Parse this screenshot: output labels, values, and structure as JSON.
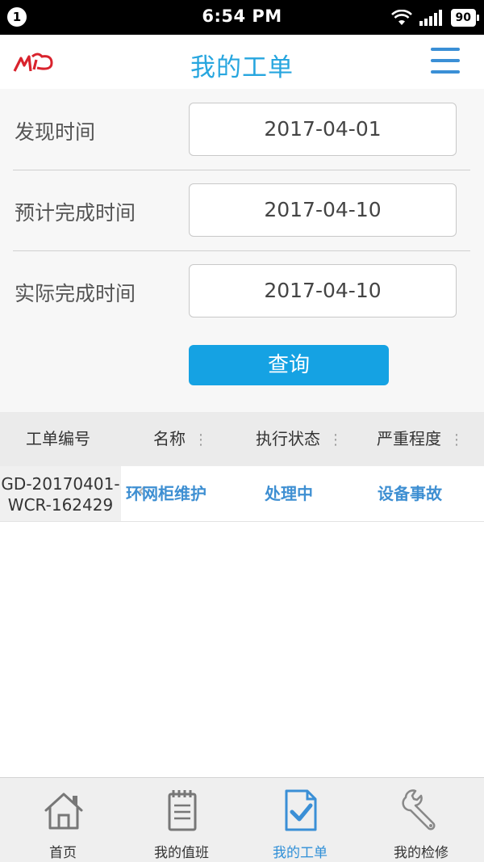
{
  "status_bar": {
    "notification_count": "1",
    "time": "6:54 PM",
    "battery": "90",
    "icons": [
      "wifi-icon",
      "signal-icon",
      "battery-icon"
    ]
  },
  "header": {
    "title": "我的工单",
    "logo_icon": "logo-icon",
    "menu_icon": "hamburger-menu-icon"
  },
  "filters": {
    "discover_time": {
      "label": "发现时间",
      "value": "2017-04-01"
    },
    "planned_time": {
      "label": "预计完成时间",
      "value": "2017-04-10"
    },
    "actual_time": {
      "label": "实际完成时间",
      "value": "2017-04-10"
    },
    "query_label": "查询"
  },
  "table": {
    "columns": [
      "工单编号",
      "名称",
      "执行状态",
      "严重程度"
    ],
    "rows": [
      {
        "id_line1": "GD-20170401-",
        "id_line2": "WCR-162429",
        "name": "环网柜维护",
        "status": "处理中",
        "severity": "设备事故"
      }
    ]
  },
  "bottom_nav": {
    "items": [
      {
        "label": "首页",
        "icon": "home-icon"
      },
      {
        "label": "我的值班",
        "icon": "notepad-icon"
      },
      {
        "label": "我的工单",
        "icon": "document-check-icon"
      },
      {
        "label": "我的检修",
        "icon": "wrench-icon"
      }
    ],
    "active": "我的工单"
  },
  "colors": {
    "accent": "#27a6df",
    "button": "#15a2e3",
    "link": "#3e8fd2",
    "logo_red": "#d9232d"
  }
}
